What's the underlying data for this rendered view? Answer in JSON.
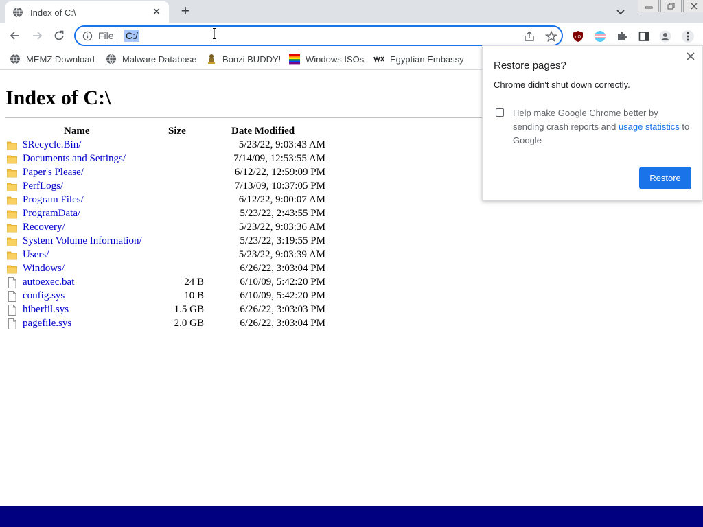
{
  "browser": {
    "tab": {
      "title": "Index of C:\\"
    },
    "omnibox": {
      "scheme_label": "File",
      "url": "C:/"
    }
  },
  "bookmarks": [
    {
      "label": "MEMZ Download",
      "icon": "globe-icon"
    },
    {
      "label": "Malware Database",
      "icon": "globe-icon"
    },
    {
      "label": "Bonzi BUDDY!",
      "icon": "bonzi-icon"
    },
    {
      "label": "Windows ISOs",
      "icon": "rainbow-flag-icon"
    },
    {
      "label": "Egyptian Embassy",
      "icon": "wix-icon"
    }
  ],
  "page": {
    "title": "Index of C:\\",
    "headers": {
      "name": "Name",
      "size": "Size",
      "date": "Date Modified"
    },
    "rows": [
      {
        "name": "$Recycle.Bin/",
        "size": "",
        "date": "5/23/22, 9:03:43 AM",
        "type": "folder"
      },
      {
        "name": "Documents and Settings/",
        "size": "",
        "date": "7/14/09, 12:53:55 AM",
        "type": "folder"
      },
      {
        "name": "Paper's Please/",
        "size": "",
        "date": "6/12/22, 12:59:09 PM",
        "type": "folder"
      },
      {
        "name": "PerfLogs/",
        "size": "",
        "date": "7/13/09, 10:37:05 PM",
        "type": "folder"
      },
      {
        "name": "Program Files/",
        "size": "",
        "date": "6/12/22, 9:00:07 AM",
        "type": "folder"
      },
      {
        "name": "ProgramData/",
        "size": "",
        "date": "5/23/22, 2:43:55 PM",
        "type": "folder"
      },
      {
        "name": "Recovery/",
        "size": "",
        "date": "5/23/22, 9:03:36 AM",
        "type": "folder"
      },
      {
        "name": "System Volume Information/",
        "size": "",
        "date": "5/23/22, 3:19:55 PM",
        "type": "folder"
      },
      {
        "name": "Users/",
        "size": "",
        "date": "5/23/22, 9:03:39 AM",
        "type": "folder"
      },
      {
        "name": "Windows/",
        "size": "",
        "date": "6/26/22, 3:03:04 PM",
        "type": "folder"
      },
      {
        "name": "autoexec.bat",
        "size": "24 B",
        "date": "6/10/09, 5:42:20 PM",
        "type": "file"
      },
      {
        "name": "config.sys",
        "size": "10 B",
        "date": "6/10/09, 5:42:20 PM",
        "type": "file"
      },
      {
        "name": "hiberfil.sys",
        "size": "1.5 GB",
        "date": "6/26/22, 3:03:03 PM",
        "type": "file"
      },
      {
        "name": "pagefile.sys",
        "size": "2.0 GB",
        "date": "6/26/22, 3:03:04 PM",
        "type": "file"
      }
    ]
  },
  "popup": {
    "title": "Restore pages?",
    "message": "Chrome didn't shut down correctly.",
    "help_text": "Help make Google Chrome better by sending crash reports and ",
    "help_link": "usage statistics",
    "help_tail": " to Google",
    "button": "Restore"
  },
  "colors": {
    "accent": "#1a73e8",
    "link": "#0000cc",
    "folder": "#f5c242",
    "taskbar": "#000080"
  }
}
